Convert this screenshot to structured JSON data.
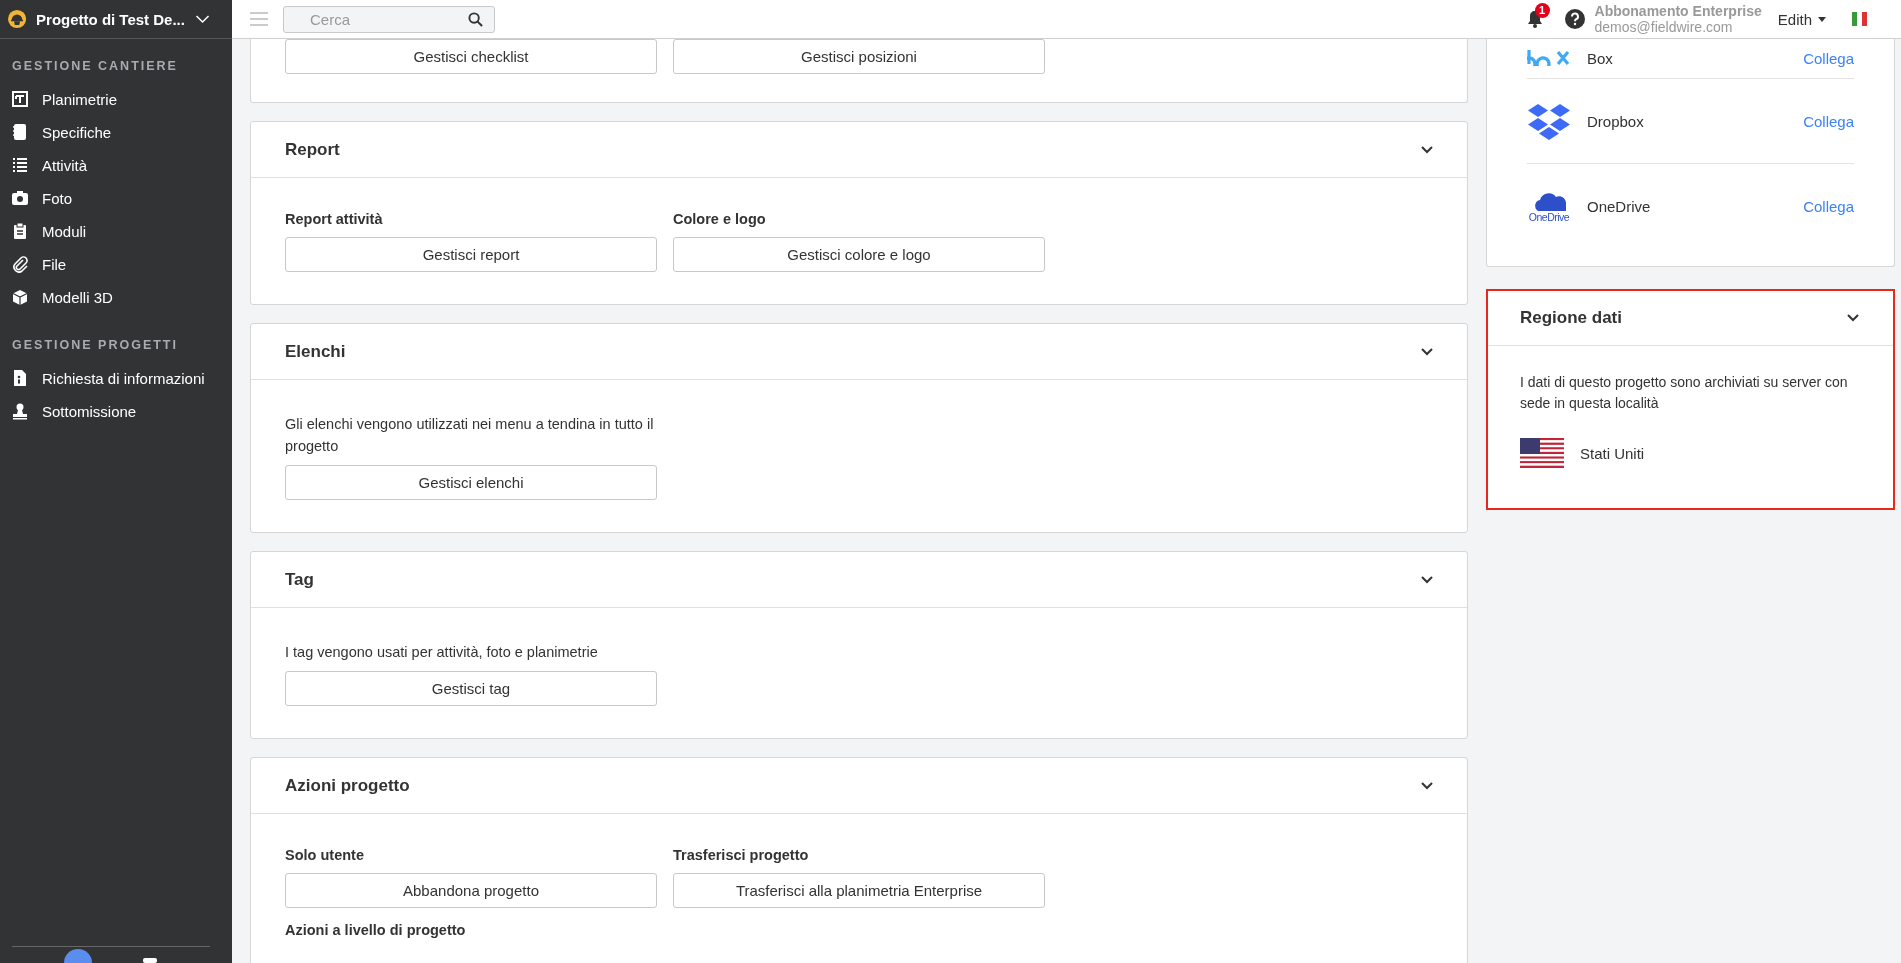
{
  "project": {
    "name": "Progetto di Test De..."
  },
  "sidebar": {
    "sections": [
      {
        "title": "GESTIONE CANTIERE",
        "items": [
          {
            "label": "Planimetrie"
          },
          {
            "label": "Specifiche"
          },
          {
            "label": "Attività"
          },
          {
            "label": "Foto"
          },
          {
            "label": "Moduli"
          },
          {
            "label": "File"
          },
          {
            "label": "Modelli 3D"
          }
        ]
      },
      {
        "title": "GESTIONE PROGETTI",
        "items": [
          {
            "label": "Richiesta di informazioni"
          },
          {
            "label": "Sottomissione"
          }
        ]
      }
    ]
  },
  "topbar": {
    "search": {
      "placeholder": "Cerca"
    },
    "notifications": "1",
    "subscription": "Abbonamento Enterprise",
    "email": "demos@fieldwire.com",
    "user": "Edith"
  },
  "cards": [
    {
      "rows": [
        [
          {
            "button": "Gestisci checklist"
          },
          {
            "button": "Gestisci posizioni"
          }
        ]
      ]
    },
    {
      "title": "Report",
      "rows": [
        [
          {
            "label": "Report attività",
            "button": "Gestisci report"
          },
          {
            "label": "Colore e logo",
            "button": "Gestisci colore e logo"
          }
        ]
      ]
    },
    {
      "title": "Elenchi",
      "rows": [
        [
          {
            "description": "Gli elenchi vengono utilizzati nei menu a tendina in tutto il progetto",
            "button": "Gestisci elenchi"
          }
        ]
      ]
    },
    {
      "title": "Tag",
      "rows": [
        [
          {
            "description": "I tag vengono usati per attività, foto e planimetrie",
            "button": "Gestisci tag"
          }
        ]
      ]
    },
    {
      "title": "Azioni progetto",
      "rows": [
        [
          {
            "label": "Solo utente",
            "button": "Abbandona progetto"
          },
          {
            "label": "Trasferisci progetto",
            "button": "Trasferisci alla planimetria Enterprise"
          }
        ],
        [
          {
            "label": "Azioni a livello di progetto"
          }
        ]
      ]
    }
  ],
  "integrations": [
    {
      "name": "Box",
      "action": "Collega"
    },
    {
      "name": "Dropbox",
      "action": "Collega"
    },
    {
      "name": "OneDrive",
      "action": "Collega",
      "logo_text": "OneDrive"
    }
  ],
  "region": {
    "title": "Regione dati",
    "description": "I dati di questo progetto sono archiviati su server con sede in questa località",
    "country": "Stati Uniti",
    "highlighted": true
  }
}
